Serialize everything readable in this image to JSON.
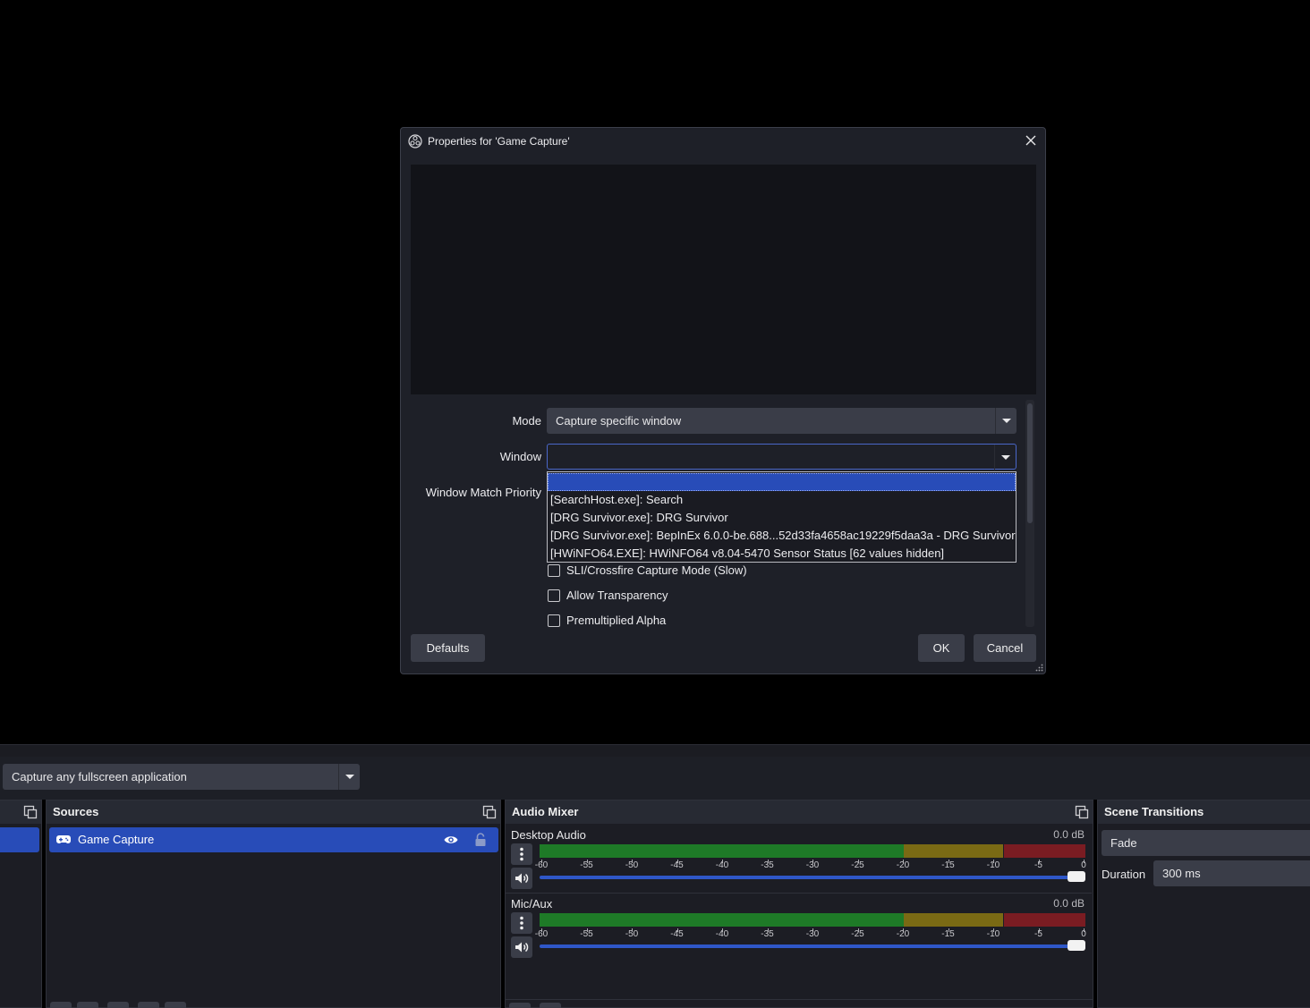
{
  "dialog": {
    "title": "Properties for 'Game Capture'",
    "fields": {
      "mode_label": "Mode",
      "mode_value": "Capture specific window",
      "window_label": "Window",
      "window_value": "",
      "match_priority_label": "Window Match Priority"
    },
    "window_options": [
      "",
      "[SearchHost.exe]: Search",
      "[DRG Survivor.exe]: DRG Survivor",
      "[DRG Survivor.exe]: BepInEx 6.0.0-be.688...52d33fa4658ac19229f5daa3a - DRG Survivor",
      "[HWiNFO64.EXE]: HWiNFO64 v8.04-5470 Sensor Status [62 values hidden]"
    ],
    "selected_window_index": 0,
    "checkboxes": [
      {
        "label": "SLI/Crossfire Capture Mode (Slow)",
        "checked": false
      },
      {
        "label": "Allow Transparency",
        "checked": false
      },
      {
        "label": "Premultiplied Alpha",
        "checked": false
      }
    ],
    "buttons": {
      "defaults": "Defaults",
      "ok": "OK",
      "cancel": "Cancel"
    }
  },
  "context_bar": {
    "mode_value": "Capture any fullscreen application"
  },
  "sources": {
    "title": "Sources",
    "items": [
      {
        "name": "Game Capture",
        "visible": true,
        "locked": false,
        "icon": "gamepad-icon"
      }
    ]
  },
  "audio_mixer": {
    "title": "Audio Mixer",
    "tick_labels": [
      "-60",
      "-55",
      "-50",
      "-45",
      "-40",
      "-35",
      "-30",
      "-25",
      "-20",
      "-15",
      "-10",
      "-5",
      "0"
    ],
    "channels": [
      {
        "name": "Desktop Audio",
        "db": "0.0 dB",
        "volume": 1.0
      },
      {
        "name": "Mic/Aux",
        "db": "0.0 dB",
        "volume": 1.0
      }
    ]
  },
  "scene_transitions": {
    "title": "Scene Transitions",
    "transition": "Fade",
    "duration_label": "Duration",
    "duration_value": "300 ms"
  },
  "colors": {
    "accent": "#284cb8",
    "meter_green": "#1e7a27",
    "meter_yellow": "#7a6a14",
    "meter_red": "#7a1c22"
  }
}
